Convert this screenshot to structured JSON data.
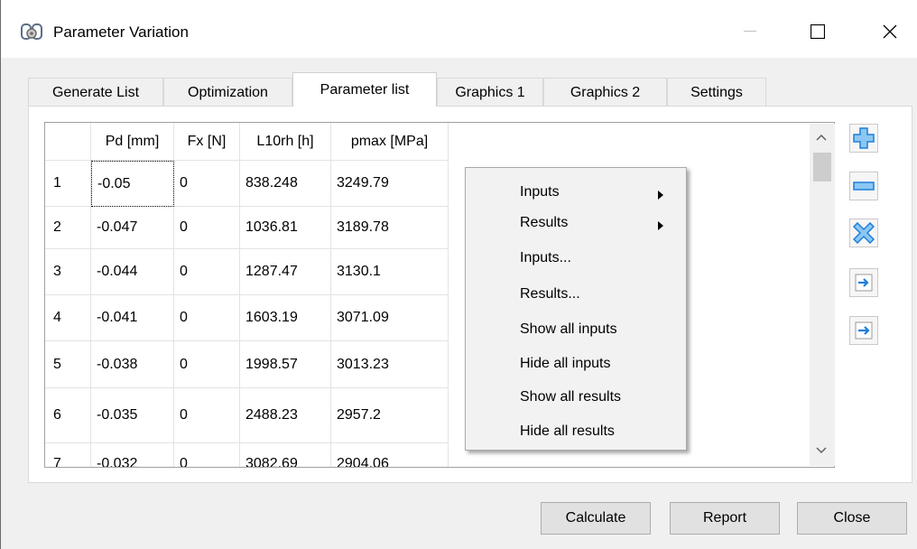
{
  "window": {
    "title": "Parameter Variation",
    "app_icon": "app-logo-icon",
    "controls": {
      "minimize": "minimize-icon",
      "maximize": "maximize-icon",
      "close": "close-icon"
    }
  },
  "tabs": [
    {
      "label": "Generate List"
    },
    {
      "label": "Optimization"
    },
    {
      "label": "Parameter list",
      "active": true
    },
    {
      "label": "Graphics 1"
    },
    {
      "label": "Graphics 2"
    },
    {
      "label": "Settings"
    }
  ],
  "table": {
    "columns": [
      "Pd [mm]",
      "Fx [N]",
      "L10rh [h]",
      "pmax [MPa]"
    ],
    "rows": [
      {
        "num": "1",
        "cells": [
          "-0.05",
          "0",
          "838.248",
          "3249.79"
        ]
      },
      {
        "num": "2",
        "cells": [
          "-0.047",
          "0",
          "1036.81",
          "3189.78"
        ]
      },
      {
        "num": "3",
        "cells": [
          "-0.044",
          "0",
          "1287.47",
          "3130.1"
        ]
      },
      {
        "num": "4",
        "cells": [
          "-0.041",
          "0",
          "1603.19",
          "3071.09"
        ]
      },
      {
        "num": "5",
        "cells": [
          "-0.038",
          "0",
          "1998.57",
          "3013.23"
        ]
      },
      {
        "num": "6",
        "cells": [
          "-0.035",
          "0",
          "2488.23",
          "2957.2"
        ]
      },
      {
        "num": "7",
        "cells": [
          "-0.032",
          "0",
          "3082.69",
          "2904.06"
        ]
      }
    ]
  },
  "context_menu": {
    "items": [
      {
        "label": "Inputs",
        "submenu": true
      },
      {
        "label": "Results",
        "submenu": true
      },
      {
        "label": "Inputs..."
      },
      {
        "label": "Results..."
      },
      {
        "label": "Show all inputs"
      },
      {
        "label": "Hide all inputs"
      },
      {
        "label": "Show all results"
      },
      {
        "label": "Hide all results"
      }
    ]
  },
  "side_buttons": [
    "add-row-icon",
    "remove-row-icon",
    "delete-all-icon",
    "import-icon",
    "export-icon"
  ],
  "colors": {
    "accent_blue": "#1e7fd8",
    "accent_light": "#8cc7f3"
  },
  "buttons": {
    "calculate": "Calculate",
    "report": "Report",
    "close": "Close"
  }
}
